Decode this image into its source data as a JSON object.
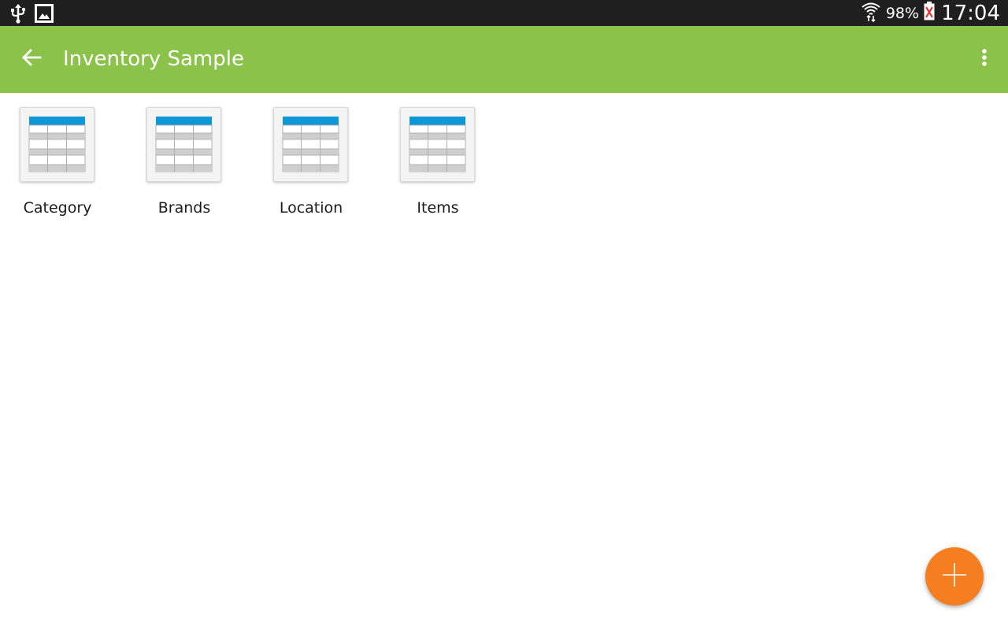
{
  "status_bar": {
    "left_icons": [
      "usb-icon",
      "image-icon"
    ],
    "battery_percent": "98%",
    "time": "17:04"
  },
  "app_bar": {
    "title": "Inventory Sample",
    "background_color": "#8bc34a",
    "back_icon": "arrow-back-icon",
    "menu_icon": "more-vert-icon"
  },
  "tables": [
    {
      "label": "Category",
      "icon": "table-icon"
    },
    {
      "label": "Brands",
      "icon": "table-icon"
    },
    {
      "label": "Location",
      "icon": "table-icon"
    },
    {
      "label": "Items",
      "icon": "table-icon"
    }
  ],
  "fab": {
    "icon": "plus-icon",
    "color": "#f57f20"
  }
}
